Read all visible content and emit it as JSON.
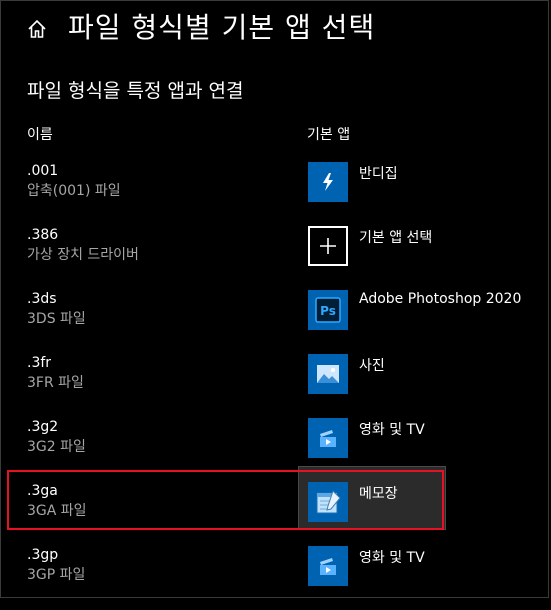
{
  "header": {
    "home_icon": "home-icon",
    "title": "파일 형식별 기본 앱 선택"
  },
  "section": {
    "title": "파일 형식을 특정 앱과 연결"
  },
  "columns": {
    "name": "이름",
    "default_app": "기본 앱"
  },
  "rows": [
    {
      "ext": ".001",
      "desc": "압축(001) 파일",
      "app": "반디집",
      "icon": "bandizip-icon"
    },
    {
      "ext": ".386",
      "desc": "가상 장치 드라이버",
      "app": "기본 앱 선택",
      "icon": "plus-icon"
    },
    {
      "ext": ".3ds",
      "desc": "3DS 파일",
      "app": "Adobe Photoshop 2020",
      "icon": "photoshop-icon"
    },
    {
      "ext": ".3fr",
      "desc": "3FR 파일",
      "app": "사진",
      "icon": "photos-icon"
    },
    {
      "ext": ".3g2",
      "desc": "3G2 파일",
      "app": "영화 및 TV",
      "icon": "movies-tv-icon"
    },
    {
      "ext": ".3ga",
      "desc": "3GA 파일",
      "app": "메모장",
      "icon": "notepad-icon"
    },
    {
      "ext": ".3gp",
      "desc": "3GP 파일",
      "app": "영화 및 TV",
      "icon": "movies-tv-icon"
    }
  ],
  "colors": {
    "tile_blue": "#0063b1",
    "highlight": "#e81123"
  }
}
